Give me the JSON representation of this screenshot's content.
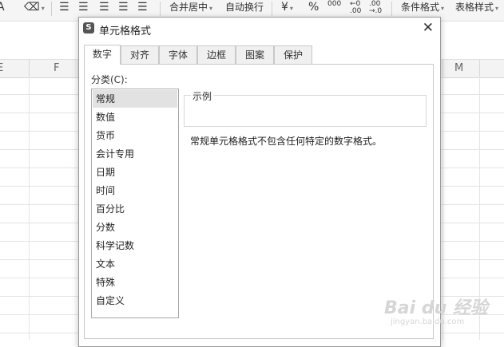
{
  "toolbar": {
    "eraser_icon": "eraser-icon",
    "merge_center": "合并居中",
    "auto_wrap": "自动换行",
    "currency_symbol": "¥",
    "percent_symbol": "%",
    "thousands_symbol": "000",
    "increase_decimal_top": "←0",
    "increase_decimal_bottom": ".00",
    "decrease_decimal_top": ".00",
    "decrease_decimal_bottom": "→.0",
    "conditional_format": "条件格式",
    "table_style": "表格样式"
  },
  "sheet": {
    "columns": [
      "E",
      "F",
      "M"
    ]
  },
  "dialog": {
    "logo": "S",
    "title": "单元格格式",
    "close": "✕",
    "tabs": [
      {
        "label": "数字",
        "active": true
      },
      {
        "label": "对齐",
        "active": false
      },
      {
        "label": "字体",
        "active": false
      },
      {
        "label": "边框",
        "active": false
      },
      {
        "label": "图案",
        "active": false
      },
      {
        "label": "保护",
        "active": false
      }
    ],
    "category_label": "分类(C):",
    "categories": [
      "常规",
      "数值",
      "货币",
      "会计专用",
      "日期",
      "时间",
      "百分比",
      "分数",
      "科学记数",
      "文本",
      "特殊",
      "自定义"
    ],
    "selected_category": "常规",
    "sample_label": "示例",
    "description": "常规单元格格式不包含任何特定的数字格式。"
  },
  "watermark": {
    "main": "Bai du 经验",
    "sub": "jingyan.baidu.com"
  }
}
